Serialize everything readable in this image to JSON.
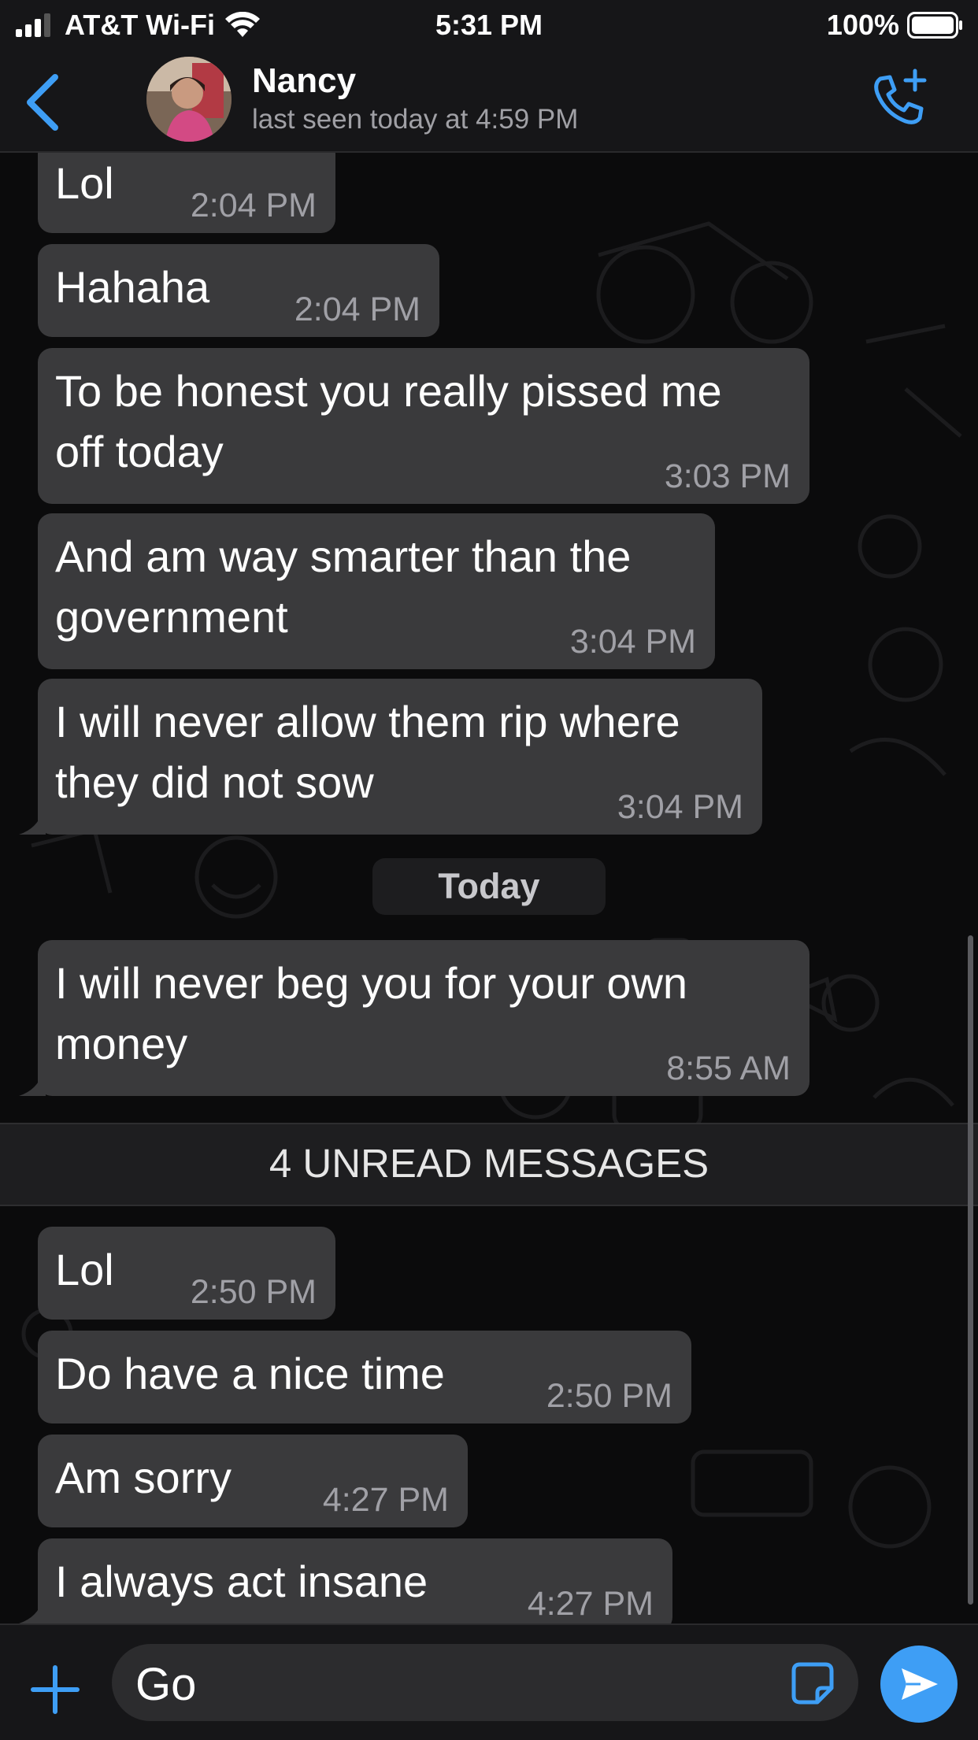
{
  "status_bar": {
    "carrier": "AT&T Wi-Fi",
    "time": "5:31 PM",
    "battery": "100%"
  },
  "header": {
    "contact_name": "Nancy",
    "last_seen": "last seen today at 4:59 PM"
  },
  "messages_before": [
    {
      "text": "Lol",
      "time": "2:04 PM"
    },
    {
      "text": "Hahaha",
      "time": "2:04 PM"
    },
    {
      "text": "To be honest you really pissed me\noff today",
      "time": "3:03 PM"
    },
    {
      "text": "And am way smarter than the\ngovernment",
      "time": "3:04 PM"
    },
    {
      "text": "I will never allow them rip where\nthey did not sow",
      "time": "3:04 PM"
    }
  ],
  "day_separator": "Today",
  "today_message": {
    "text": "I will never beg you for your own\nmoney",
    "time": "8:55 AM"
  },
  "unread_banner": "4 UNREAD MESSAGES",
  "messages_unread": [
    {
      "text": "Lol",
      "time": "2:50 PM"
    },
    {
      "text": "Do have a nice time",
      "time": "2:50 PM"
    },
    {
      "text": "Am sorry",
      "time": "4:27 PM"
    },
    {
      "text": "I always act insane",
      "time": "4:27 PM"
    }
  ],
  "composer": {
    "value": "Go"
  },
  "colors": {
    "accent": "#3e9ef5",
    "bubble": "#3a3a3c",
    "background": "#0b0b0c"
  }
}
